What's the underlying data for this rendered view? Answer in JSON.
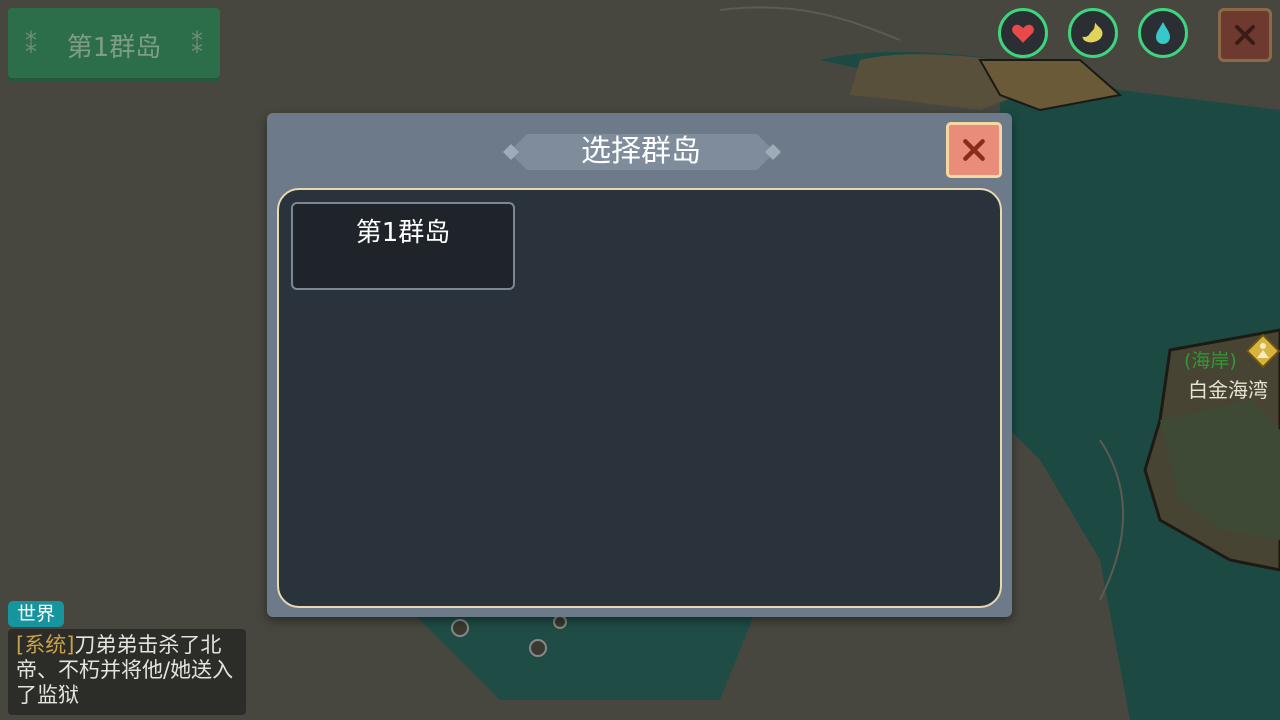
{
  "header": {
    "region_button_label": "第1群岛",
    "status_icons": [
      {
        "name": "heart-icon",
        "color": "#e84a4a"
      },
      {
        "name": "stomach-icon",
        "color": "#e2d45a"
      },
      {
        "name": "water-drop-icon",
        "color": "#37c9c9"
      }
    ],
    "close_icon": "close-icon"
  },
  "modal": {
    "title": "选择群岛",
    "close_icon": "close-icon",
    "islands": [
      {
        "label": "第1群岛"
      }
    ]
  },
  "map": {
    "poi_tag": "(海岸)",
    "poi_name": "白金海湾"
  },
  "chat": {
    "channel": "世界",
    "messages": [
      {
        "tag": "[系统]",
        "text": "刀弟弟击杀了北帝、不朽并将他/她送入了监狱"
      }
    ]
  },
  "colors": {
    "accent_green": "#3ed57f",
    "modal_close": "#e98d7a",
    "chat_channel": "#16959f"
  }
}
